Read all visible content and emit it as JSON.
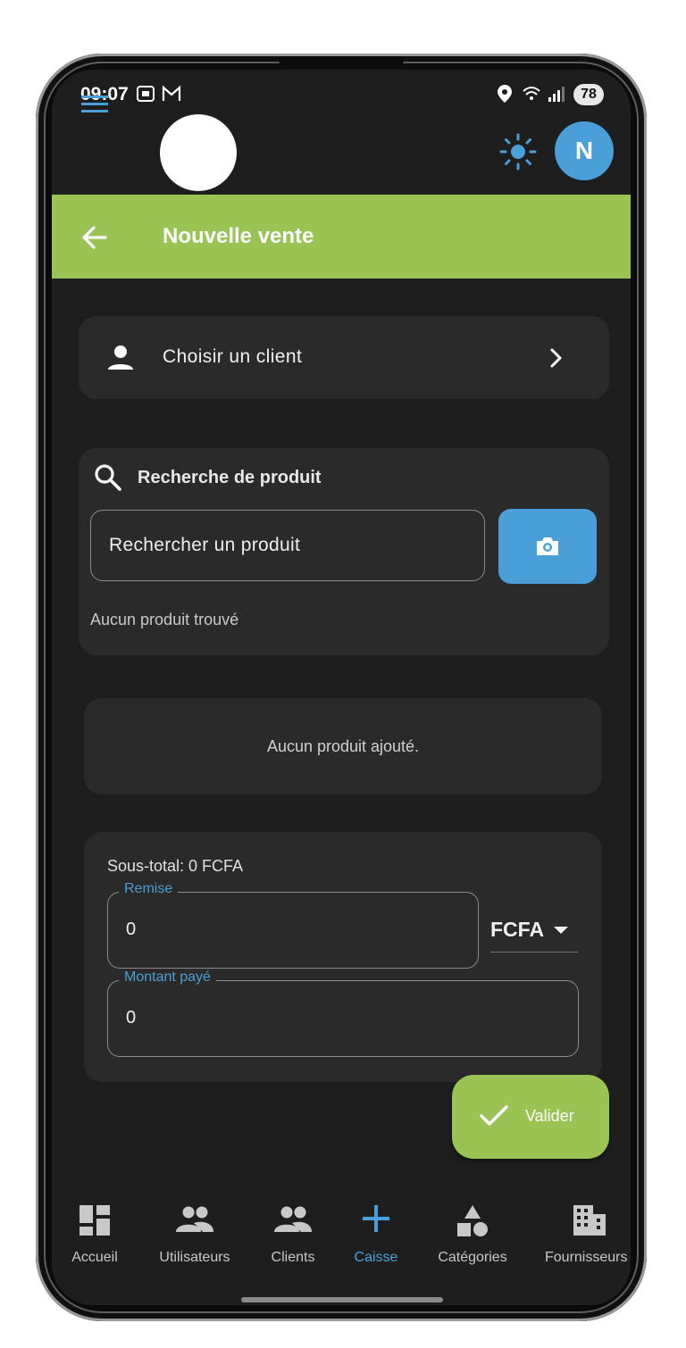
{
  "status_bar": {
    "time": "09:07",
    "battery": "78"
  },
  "top_bar": {
    "avatar_initial": "N"
  },
  "app_bar": {
    "title": "Nouvelle vente"
  },
  "client": {
    "label": "Choisir un client"
  },
  "product_search": {
    "title": "Recherche de produit",
    "placeholder": "Rechercher un produit",
    "empty_message": "Aucun produit trouvé"
  },
  "cart": {
    "empty_message": "Aucun produit ajouté."
  },
  "totals": {
    "subtotal": "Sous-total: 0 FCFA",
    "discount_label": "Remise",
    "discount_value": "0",
    "currency": "FCFA",
    "paid_label": "Montant payé",
    "paid_value": "0"
  },
  "fab": {
    "label": "Valider"
  },
  "bottom_nav": {
    "items": [
      {
        "label": "Accueil",
        "icon": "dashboard-icon"
      },
      {
        "label": "Utilisateurs",
        "icon": "people-icon"
      },
      {
        "label": "Clients",
        "icon": "people-icon"
      },
      {
        "label": "Caisse",
        "icon": "plus-icon",
        "active": true
      },
      {
        "label": "Catégories",
        "icon": "category-shapes-icon"
      },
      {
        "label": "Fournisseurs",
        "icon": "building-icon"
      }
    ]
  },
  "colors": {
    "accent_green": "#99c454",
    "accent_blue": "#4a9fd8",
    "background": "#1e1e1e",
    "card": "#2a2a2a"
  }
}
